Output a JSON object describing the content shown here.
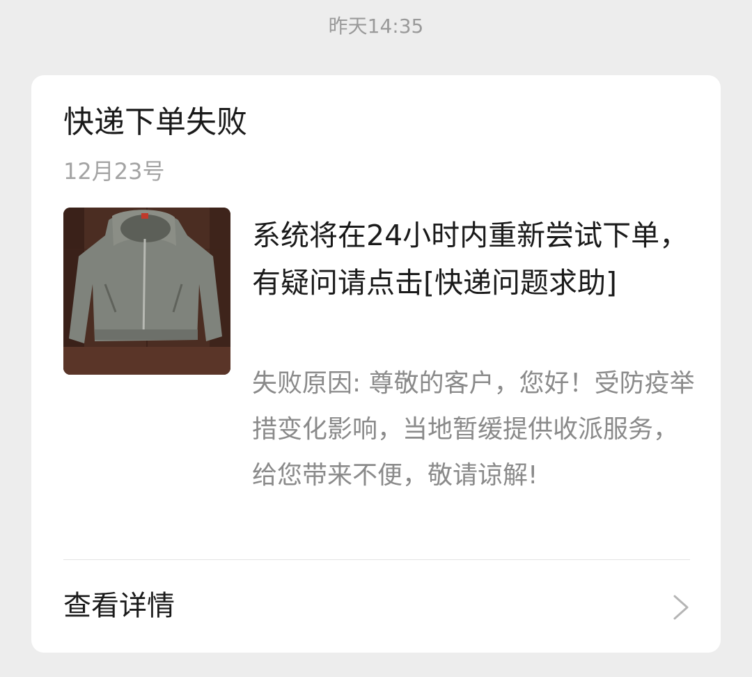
{
  "header": {
    "timestamp": "昨天14:35"
  },
  "card": {
    "title": "快递下单失败",
    "date": "12月23号",
    "headline": "系统将在24小时内重新尝试下单，有疑问请点击[快递问题求助]",
    "reason": "失败原因: 尊敬的客户，您好！受防疫举措变化影响，当地暂缓提供收派服务，给您带来不便，敬请谅解!",
    "detail_label": "查看详情",
    "detail_icon": "chevron-right-icon",
    "thumbnail": "jacket-photo"
  }
}
